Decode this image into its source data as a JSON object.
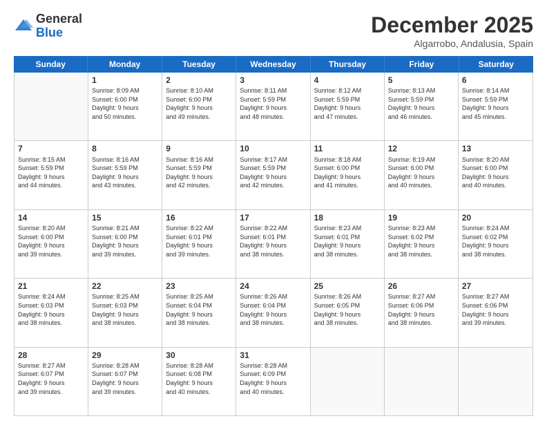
{
  "logo": {
    "general": "General",
    "blue": "Blue"
  },
  "header": {
    "month": "December 2025",
    "location": "Algarrobo, Andalusia, Spain"
  },
  "weekdays": [
    "Sunday",
    "Monday",
    "Tuesday",
    "Wednesday",
    "Thursday",
    "Friday",
    "Saturday"
  ],
  "rows": [
    [
      {
        "day": "",
        "lines": [],
        "empty": true
      },
      {
        "day": "1",
        "lines": [
          "Sunrise: 8:09 AM",
          "Sunset: 6:00 PM",
          "Daylight: 9 hours",
          "and 50 minutes."
        ]
      },
      {
        "day": "2",
        "lines": [
          "Sunrise: 8:10 AM",
          "Sunset: 6:00 PM",
          "Daylight: 9 hours",
          "and 49 minutes."
        ]
      },
      {
        "day": "3",
        "lines": [
          "Sunrise: 8:11 AM",
          "Sunset: 5:59 PM",
          "Daylight: 9 hours",
          "and 48 minutes."
        ]
      },
      {
        "day": "4",
        "lines": [
          "Sunrise: 8:12 AM",
          "Sunset: 5:59 PM",
          "Daylight: 9 hours",
          "and 47 minutes."
        ]
      },
      {
        "day": "5",
        "lines": [
          "Sunrise: 8:13 AM",
          "Sunset: 5:59 PM",
          "Daylight: 9 hours",
          "and 46 minutes."
        ]
      },
      {
        "day": "6",
        "lines": [
          "Sunrise: 8:14 AM",
          "Sunset: 5:59 PM",
          "Daylight: 9 hours",
          "and 45 minutes."
        ]
      }
    ],
    [
      {
        "day": "7",
        "lines": [
          "Sunrise: 8:15 AM",
          "Sunset: 5:59 PM",
          "Daylight: 9 hours",
          "and 44 minutes."
        ]
      },
      {
        "day": "8",
        "lines": [
          "Sunrise: 8:16 AM",
          "Sunset: 5:59 PM",
          "Daylight: 9 hours",
          "and 43 minutes."
        ]
      },
      {
        "day": "9",
        "lines": [
          "Sunrise: 8:16 AM",
          "Sunset: 5:59 PM",
          "Daylight: 9 hours",
          "and 42 minutes."
        ]
      },
      {
        "day": "10",
        "lines": [
          "Sunrise: 8:17 AM",
          "Sunset: 5:59 PM",
          "Daylight: 9 hours",
          "and 42 minutes."
        ]
      },
      {
        "day": "11",
        "lines": [
          "Sunrise: 8:18 AM",
          "Sunset: 6:00 PM",
          "Daylight: 9 hours",
          "and 41 minutes."
        ]
      },
      {
        "day": "12",
        "lines": [
          "Sunrise: 8:19 AM",
          "Sunset: 6:00 PM",
          "Daylight: 9 hours",
          "and 40 minutes."
        ]
      },
      {
        "day": "13",
        "lines": [
          "Sunrise: 8:20 AM",
          "Sunset: 6:00 PM",
          "Daylight: 9 hours",
          "and 40 minutes."
        ]
      }
    ],
    [
      {
        "day": "14",
        "lines": [
          "Sunrise: 8:20 AM",
          "Sunset: 6:00 PM",
          "Daylight: 9 hours",
          "and 39 minutes."
        ]
      },
      {
        "day": "15",
        "lines": [
          "Sunrise: 8:21 AM",
          "Sunset: 6:00 PM",
          "Daylight: 9 hours",
          "and 39 minutes."
        ]
      },
      {
        "day": "16",
        "lines": [
          "Sunrise: 8:22 AM",
          "Sunset: 6:01 PM",
          "Daylight: 9 hours",
          "and 39 minutes."
        ]
      },
      {
        "day": "17",
        "lines": [
          "Sunrise: 8:22 AM",
          "Sunset: 6:01 PM",
          "Daylight: 9 hours",
          "and 38 minutes."
        ]
      },
      {
        "day": "18",
        "lines": [
          "Sunrise: 8:23 AM",
          "Sunset: 6:01 PM",
          "Daylight: 9 hours",
          "and 38 minutes."
        ]
      },
      {
        "day": "19",
        "lines": [
          "Sunrise: 8:23 AM",
          "Sunset: 6:02 PM",
          "Daylight: 9 hours",
          "and 38 minutes."
        ]
      },
      {
        "day": "20",
        "lines": [
          "Sunrise: 8:24 AM",
          "Sunset: 6:02 PM",
          "Daylight: 9 hours",
          "and 38 minutes."
        ]
      }
    ],
    [
      {
        "day": "21",
        "lines": [
          "Sunrise: 8:24 AM",
          "Sunset: 6:03 PM",
          "Daylight: 9 hours",
          "and 38 minutes."
        ]
      },
      {
        "day": "22",
        "lines": [
          "Sunrise: 8:25 AM",
          "Sunset: 6:03 PM",
          "Daylight: 9 hours",
          "and 38 minutes."
        ]
      },
      {
        "day": "23",
        "lines": [
          "Sunrise: 8:25 AM",
          "Sunset: 6:04 PM",
          "Daylight: 9 hours",
          "and 38 minutes."
        ]
      },
      {
        "day": "24",
        "lines": [
          "Sunrise: 8:26 AM",
          "Sunset: 6:04 PM",
          "Daylight: 9 hours",
          "and 38 minutes."
        ]
      },
      {
        "day": "25",
        "lines": [
          "Sunrise: 8:26 AM",
          "Sunset: 6:05 PM",
          "Daylight: 9 hours",
          "and 38 minutes."
        ]
      },
      {
        "day": "26",
        "lines": [
          "Sunrise: 8:27 AM",
          "Sunset: 6:06 PM",
          "Daylight: 9 hours",
          "and 38 minutes."
        ]
      },
      {
        "day": "27",
        "lines": [
          "Sunrise: 8:27 AM",
          "Sunset: 6:06 PM",
          "Daylight: 9 hours",
          "and 39 minutes."
        ]
      }
    ],
    [
      {
        "day": "28",
        "lines": [
          "Sunrise: 8:27 AM",
          "Sunset: 6:07 PM",
          "Daylight: 9 hours",
          "and 39 minutes."
        ]
      },
      {
        "day": "29",
        "lines": [
          "Sunrise: 8:28 AM",
          "Sunset: 6:07 PM",
          "Daylight: 9 hours",
          "and 39 minutes."
        ]
      },
      {
        "day": "30",
        "lines": [
          "Sunrise: 8:28 AM",
          "Sunset: 6:08 PM",
          "Daylight: 9 hours",
          "and 40 minutes."
        ]
      },
      {
        "day": "31",
        "lines": [
          "Sunrise: 8:28 AM",
          "Sunset: 6:09 PM",
          "Daylight: 9 hours",
          "and 40 minutes."
        ]
      },
      {
        "day": "",
        "lines": [],
        "empty": true
      },
      {
        "day": "",
        "lines": [],
        "empty": true
      },
      {
        "day": "",
        "lines": [],
        "empty": true
      }
    ]
  ]
}
